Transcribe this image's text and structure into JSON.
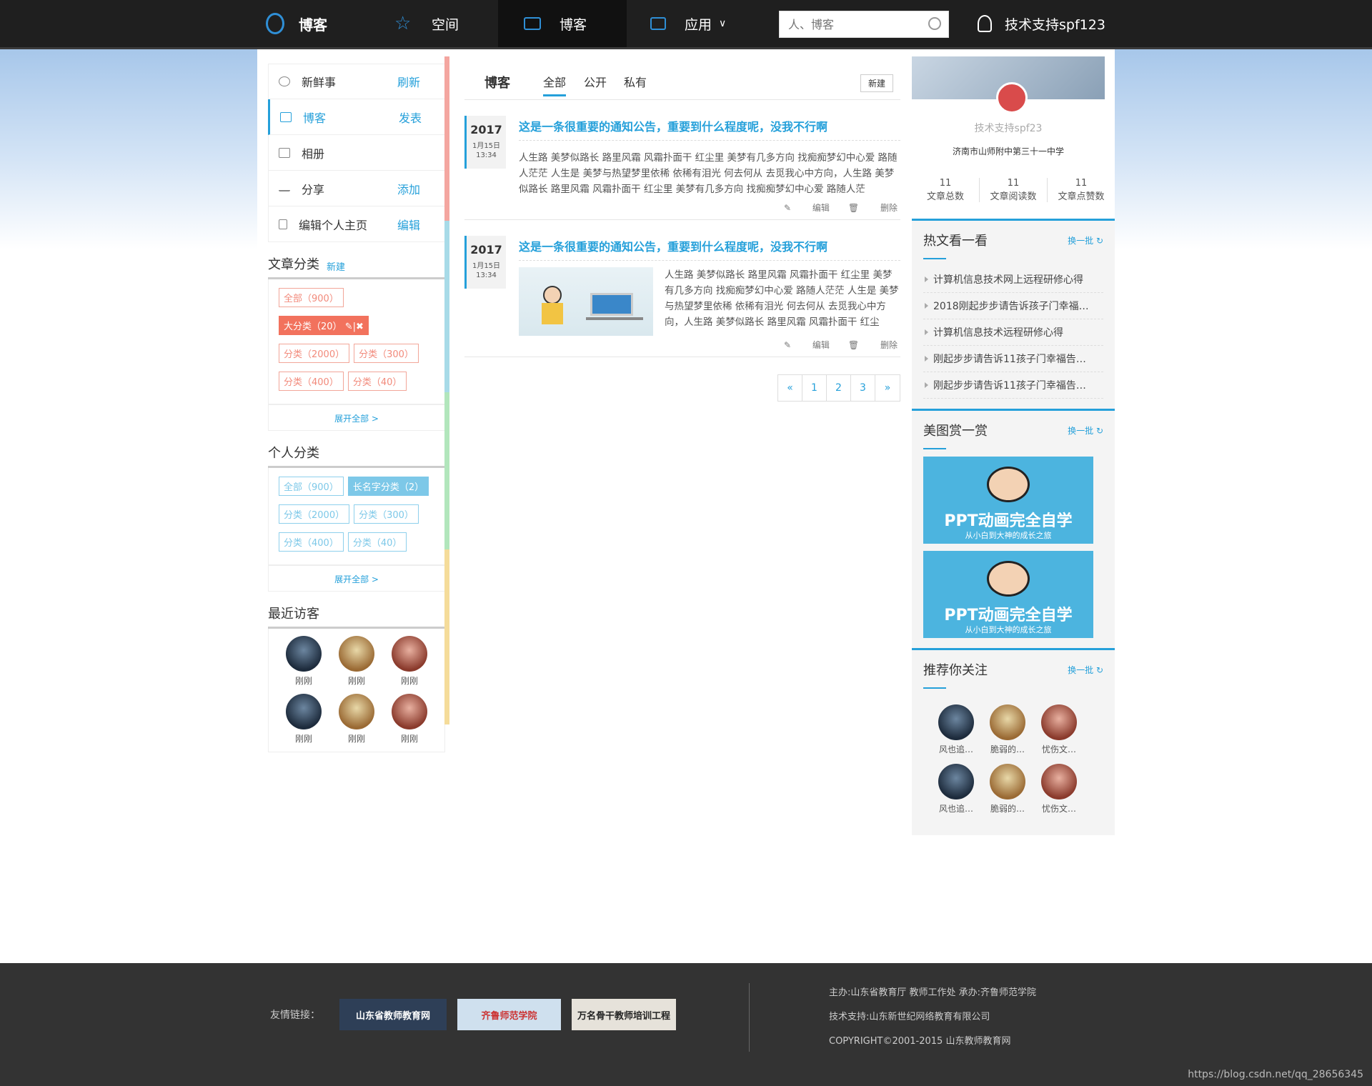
{
  "nav": {
    "logo": "博客",
    "items": [
      {
        "label": "空间"
      },
      {
        "label": "博客"
      },
      {
        "label": "应用"
      }
    ],
    "search_placeholder": "人、博客",
    "user": "技术支持spf123"
  },
  "menu": [
    {
      "label": "新鲜事",
      "action": "刷新"
    },
    {
      "label": "博客",
      "action": "发表"
    },
    {
      "label": "相册",
      "action": ""
    },
    {
      "label": "分享",
      "action": "添加"
    },
    {
      "label": "编辑个人主页",
      "action": "编辑"
    }
  ],
  "article_categories": {
    "title": "文章分类",
    "new": "新建",
    "tags": [
      "全部（900）",
      "大分类（20）",
      "分类（2000）",
      "分类（300）",
      "分类（400）",
      "分类（40）"
    ],
    "expand": "展开全部 >"
  },
  "personal_categories": {
    "title": "个人分类",
    "tags": [
      "全部（900）",
      "长名字分类（2）",
      "分类（2000）",
      "分类（300）",
      "分类（400）",
      "分类（40）"
    ],
    "expand": "展开全部 >"
  },
  "visitors": {
    "title": "最近访客",
    "items": [
      "刚刚",
      "刚刚",
      "刚刚",
      "刚刚",
      "刚刚",
      "刚刚"
    ]
  },
  "main": {
    "title": "博客",
    "tabs": [
      "全部",
      "公开",
      "私有"
    ],
    "new_btn": "新建",
    "posts": [
      {
        "year": "2017",
        "date": "1月15日",
        "time": "13:34",
        "title": "这是一条很重要的通知公告，重要到什么程度呢，没我不行啊",
        "body": "人生路 美梦似路长 路里风霜 风霜扑面干 红尘里 美梦有几多方向 找痴痴梦幻中心爱 路随人茫茫 人生是 美梦与热望梦里依稀 依稀有泪光 何去何从 去觅我心中方向，人生路 美梦似路长 路里风霜 风霜扑面干 红尘里 美梦有几多方向 找痴痴梦幻中心爱 路随人茫",
        "edit": "编辑",
        "delete": "删除"
      },
      {
        "year": "2017",
        "date": "1月15日",
        "time": "13:34",
        "title": "这是一条很重要的通知公告，重要到什么程度呢，没我不行啊",
        "body": "人生路 美梦似路长 路里风霜 风霜扑面干 红尘里 美梦有几多方向 找痴痴梦幻中心爱 路随人茫茫 人生是 美梦与热望梦里依稀 依稀有泪光 何去何从 去觅我心中方向，人生路 美梦似路长 路里风霜 风霜扑面干 红尘",
        "edit": "编辑",
        "delete": "删除"
      }
    ],
    "pager": [
      "«",
      "1",
      "2",
      "3",
      "»"
    ]
  },
  "profile": {
    "name": "技术支持spf23",
    "school": "济南市山师附中第三十一中学",
    "stats": [
      {
        "value": "11",
        "label": "文章总数"
      },
      {
        "value": "11",
        "label": "文章阅读数"
      },
      {
        "value": "11",
        "label": "文章点赞数"
      }
    ]
  },
  "hot": {
    "title": "热文看一看",
    "switch": "换一批",
    "items": [
      "计算机信息技术网上远程研修心得",
      "2018刚起步步请告诉孩子门幸福…",
      "计算机信息技术远程研修心得",
      "刚起步步请告诉11孩子门幸福告…",
      "刚起步步请告诉11孩子门幸福告…"
    ]
  },
  "images": {
    "title": "美图赏一赏",
    "switch": "换一批",
    "ppt_title": "PPT动画完全自学",
    "ppt_sub": "从小白到大神的成长之旅"
  },
  "recommend": {
    "title": "推荐你关注",
    "switch": "换一批",
    "items": [
      "风也追…",
      "脆弱的…",
      "忧伤文…",
      "风也追…",
      "脆弱的…",
      "忧伤文…"
    ]
  },
  "footer": {
    "links_label": "友情链接：",
    "logos": [
      "山东省教师教育网",
      "齐鲁师范学院",
      "万名骨干教师培训工程"
    ],
    "line1": "主办:山东省教育厅 教师工作处   承办:齐鲁师范学院",
    "line2": "技术支持:山东新世纪网络教育有限公司",
    "line3": "COPYRIGHT©2001-2015 山东教师教育网"
  },
  "watermark": "https://blog.csdn.net/qq_28656345",
  "colors": {
    "accent": "#25a0da",
    "tag_red": "#f2725d",
    "tag_blue": "#7dc8e8"
  }
}
